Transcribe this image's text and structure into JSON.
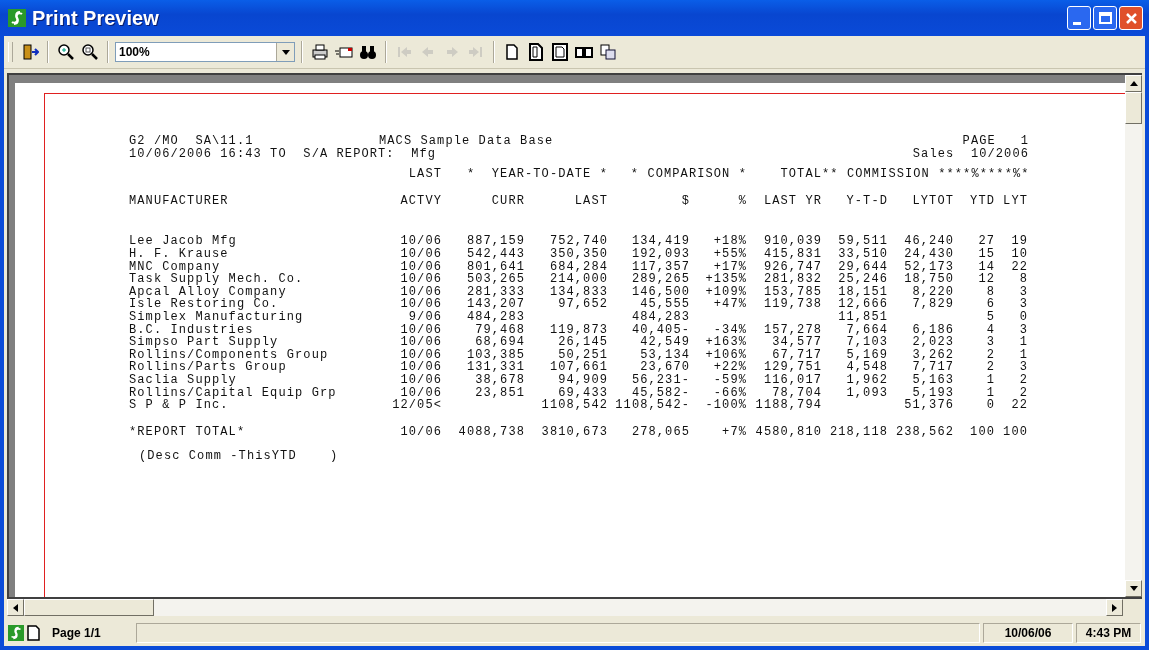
{
  "window": {
    "title": "Print Preview"
  },
  "toolbar": {
    "groups": [
      {
        "buttons": [
          {
            "kind": "exit",
            "disabled": false
          }
        ]
      },
      {
        "buttons": [
          {
            "kind": "zoom-in",
            "disabled": false
          },
          {
            "kind": "zoom-out",
            "disabled": false
          }
        ]
      },
      {
        "zoom": "100%"
      },
      {
        "buttons": [
          {
            "kind": "print",
            "disabled": false
          },
          {
            "kind": "mail",
            "disabled": false
          },
          {
            "kind": "find",
            "disabled": false
          }
        ]
      },
      {
        "buttons": [
          {
            "kind": "first",
            "disabled": true
          },
          {
            "kind": "prev",
            "disabled": true
          },
          {
            "kind": "next",
            "disabled": true
          },
          {
            "kind": "last",
            "disabled": true
          }
        ]
      },
      {
        "buttons": [
          {
            "kind": "page",
            "disabled": false
          },
          {
            "kind": "page-bold",
            "disabled": false
          },
          {
            "kind": "page-framed",
            "disabled": false
          },
          {
            "kind": "two-pages",
            "disabled": false
          },
          {
            "kind": "copy",
            "disabled": false
          }
        ]
      }
    ]
  },
  "report": {
    "header_left": [
      "G2 /MO  SA\\11.1",
      "10/06/2006 16:43 TO  S/A REPORT:  Mfg"
    ],
    "header_center": "MACS Sample Data Base",
    "header_right": [
      "PAGE   1",
      "Sales  10/2006"
    ],
    "group_headings": [
      "LAST",
      "*  YEAR-TO-DATE *",
      "* COMPARISON *",
      "TOTAL",
      "** COMMISSION ****%****%*"
    ],
    "columns": [
      "MANUFACTURER",
      "ACTVY",
      "CURR",
      "LAST",
      "$",
      "%",
      "LAST YR",
      "Y-T-D",
      "LYTOT",
      "YTD",
      "LYT"
    ],
    "rows": [
      [
        "Lee Jacob Mfg",
        "10/06",
        "887,159",
        "752,740",
        "134,419",
        "+18%",
        "910,039",
        "59,511",
        "46,240",
        "27",
        "19"
      ],
      [
        "H. F. Krause",
        "10/06",
        "542,443",
        "350,350",
        "192,093",
        "+55%",
        "415,831",
        "33,510",
        "24,430",
        "15",
        "10"
      ],
      [
        "MNC Company",
        "10/06",
        "801,641",
        "684,284",
        "117,357",
        "+17%",
        "926,747",
        "29,644",
        "52,173",
        "14",
        "22"
      ],
      [
        "Task Supply Mech. Co.",
        "10/06",
        "503,265",
        "214,000",
        "289,265",
        "+135%",
        "281,832",
        "25,246",
        "18,750",
        "12",
        "8"
      ],
      [
        "Apcal Alloy Company",
        "10/06",
        "281,333",
        "134,833",
        "146,500",
        "+109%",
        "153,785",
        "18,151",
        "8,220",
        "8",
        "3"
      ],
      [
        "Isle Restoring Co.",
        "10/06",
        "143,207",
        "97,652",
        "45,555",
        "+47%",
        "119,738",
        "12,666",
        "7,829",
        "6",
        "3"
      ],
      [
        "Simplex Manufacturing",
        "9/06",
        "484,283",
        "",
        "484,283",
        "",
        "",
        "11,851",
        "",
        "5",
        "0"
      ],
      [
        "B.C. Industries",
        "10/06",
        "79,468",
        "119,873",
        "40,405-",
        "-34%",
        "157,278",
        "7,664",
        "6,186",
        "4",
        "3"
      ],
      [
        "Simpso Part Supply",
        "10/06",
        "68,694",
        "26,145",
        "42,549",
        "+163%",
        "34,577",
        "7,103",
        "2,023",
        "3",
        "1"
      ],
      [
        "Rollins/Components Group",
        "10/06",
        "103,385",
        "50,251",
        "53,134",
        "+106%",
        "67,717",
        "5,169",
        "3,262",
        "2",
        "1"
      ],
      [
        "Rollins/Parts Group",
        "10/06",
        "131,331",
        "107,661",
        "23,670",
        "+22%",
        "129,751",
        "4,548",
        "7,717",
        "2",
        "3"
      ],
      [
        "Saclia Supply",
        "10/06",
        "38,678",
        "94,909",
        "56,231-",
        "-59%",
        "116,017",
        "1,962",
        "5,163",
        "1",
        "2"
      ],
      [
        "Rollins/Capital Equip Grp",
        "10/06",
        "23,851",
        "69,433",
        "45,582-",
        "-66%",
        "78,704",
        "1,093",
        "5,193",
        "1",
        "2"
      ],
      [
        "S P & P Inc.",
        "12/05<",
        "",
        "1108,542",
        "1108,542-",
        "-100%",
        "1188,794",
        "",
        "51,376",
        "0",
        "22"
      ]
    ],
    "total": [
      "*REPORT TOTAL*",
      "10/06",
      "4088,738",
      "3810,673",
      "278,065",
      "+7%",
      "4580,810",
      "218,118",
      "238,562",
      "100",
      "100"
    ],
    "footer": "(Desc Comm -ThisYTD    )"
  },
  "status_bar": {
    "page": "Page 1/1",
    "date": "10/06/06",
    "time": "4:43 PM"
  }
}
